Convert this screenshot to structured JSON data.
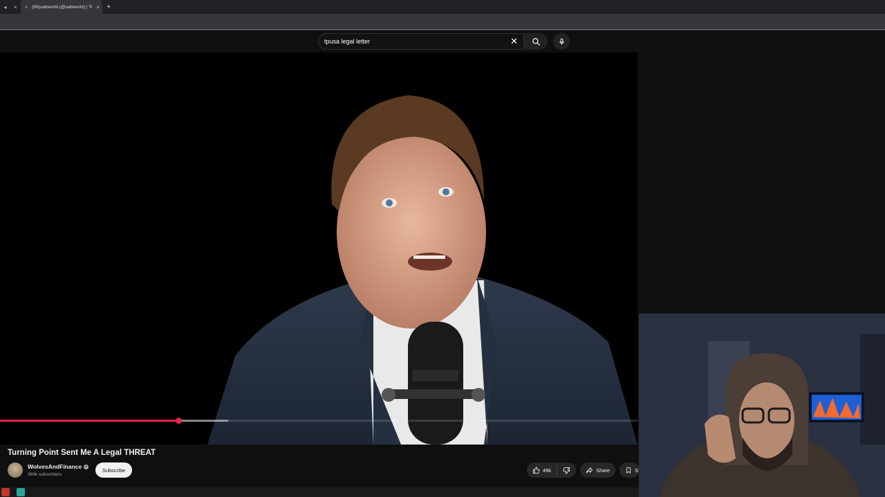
{
  "browser": {
    "tab_title": "(90)oabworld (@oabworld) | Ti",
    "tab_close": "×",
    "new_tab": "+"
  },
  "search": {
    "query": "tpusa legal letter",
    "clear": "✕"
  },
  "video": {
    "title": "Turning Point Sent Me A Legal THREAT",
    "progress_played": 0.28,
    "progress_buffered": 0.358
  },
  "channel": {
    "name": "WolvesAndFinance",
    "subscribers": "369k subscribers",
    "subscribe_label": "Subscribe"
  },
  "actions": {
    "like_count": "49k",
    "share_label": "Share",
    "save_label": "S"
  },
  "colors": {
    "progress": "#e8254a",
    "background": "#0f0f0f"
  }
}
